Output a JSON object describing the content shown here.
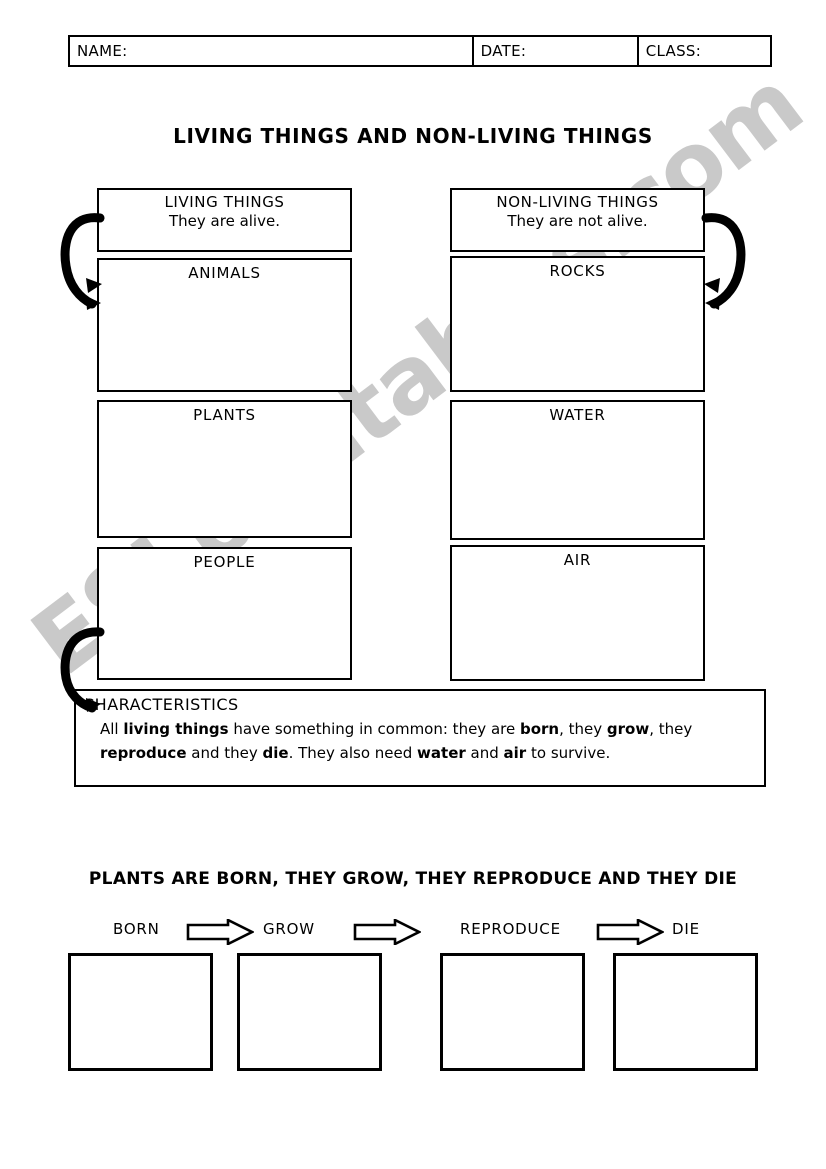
{
  "header": {
    "fields": [
      {
        "label": "NAME:",
        "value": ""
      },
      {
        "label": "DATE:",
        "value": ""
      },
      {
        "label": "CLASS:",
        "value": ""
      }
    ]
  },
  "title": "LIVING THINGS AND NON-LIVING THINGS",
  "watermark": "ESLprintables.com",
  "columns": {
    "living": {
      "heading": "LIVING THINGS",
      "subheading": "They are alive.",
      "categories": [
        {
          "label": "ANIMALS"
        },
        {
          "label": "PLANTS"
        },
        {
          "label": "PEOPLE"
        }
      ]
    },
    "nonliving": {
      "heading": "NON-LIVING THINGS",
      "subheading": "They are not alive.",
      "categories": [
        {
          "label": "ROCKS"
        },
        {
          "label": "WATER"
        },
        {
          "label": "AIR"
        }
      ]
    }
  },
  "characteristics": {
    "title": "CHARACTERISTICS",
    "line1_part1": "All ",
    "line1_bold1": "living things",
    "line1_part2": " have something in common: they are ",
    "line1_bold2": "born",
    "line1_part3": ", they ",
    "line1_bold3": "grow",
    "line1_part4": ",",
    "line2_part1": "they ",
    "line2_bold1": "reproduce",
    "line2_part2": " and they ",
    "line2_bold2": "die",
    "line2_part3": ". They also need ",
    "line2_bold3": "water",
    "line2_part4": " and ",
    "line2_bold4": "air",
    "line2_part5": " to survive."
  },
  "sequence": {
    "title": "PLANTS ARE BORN, THEY GROW, THEY REPRODUCE AND THEY DIE",
    "steps": [
      "BORN",
      "GROW",
      "REPRODUCE",
      "DIE"
    ],
    "arrow_count": 3,
    "draw_boxes": 4
  },
  "colors": {
    "ink": "#000000",
    "paper": "#ffffff",
    "watermark": "#c9c9c9"
  }
}
